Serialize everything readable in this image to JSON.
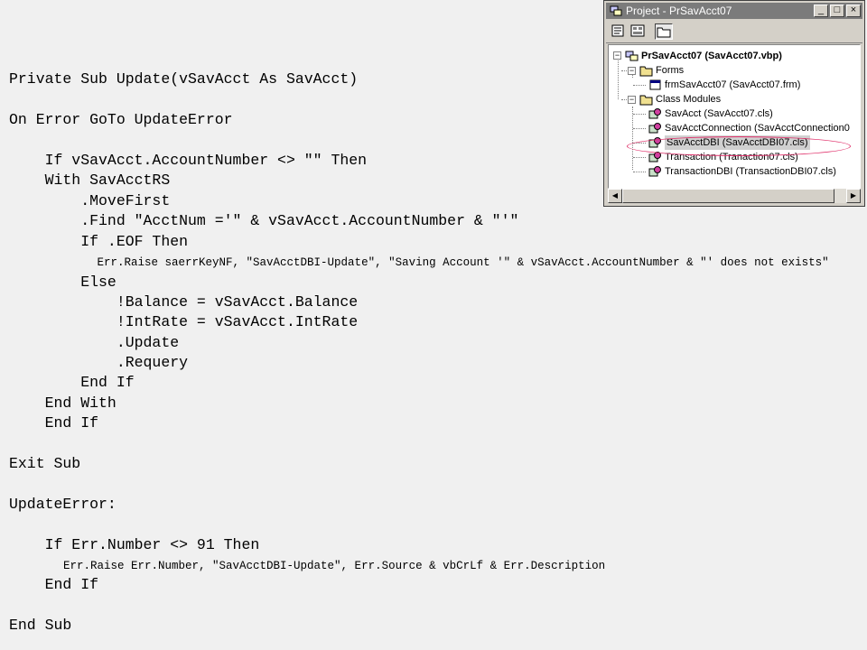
{
  "code": {
    "lines": [
      "Private Sub Update(vSavAcct As SavAcct)",
      "On Error GoTo UpdateError",
      "    If vSavAcct.AccountNumber <> \"\" Then",
      "    With SavAcctRS",
      "        .MoveFirst",
      "        .Find \"AcctNum ='\" & vSavAcct.AccountNumber & \"'\"",
      "        If .EOF Then",
      "             Err.Raise saerrKeyNF, \"SavAcctDBI-Update\", \"Saving Account '\" & vSavAcct.AccountNumber & \"' does not exists\"",
      "        Else",
      "            !Balance = vSavAcct.Balance",
      "            !IntRate = vSavAcct.IntRate",
      "            .Update",
      "            .Requery",
      "        End If",
      "    End With",
      "    End If",
      "Exit Sub",
      "UpdateError:",
      "    If Err.Number <> 91 Then",
      "        Err.Raise Err.Number, \"SavAcctDBI-Update\", Err.Source & vbCrLf & Err.Description",
      "    End If",
      "End Sub"
    ]
  },
  "project_window": {
    "title": "Project - PrSavAcct07",
    "min_glyph": "_",
    "max_glyph": "□",
    "close_glyph": "×",
    "tree": {
      "root": "PrSavAcct07 (SavAcct07.vbp)",
      "forms_folder": "Forms",
      "forms": [
        "frmSavAcct07 (SavAcct07.frm)"
      ],
      "class_folder": "Class Modules",
      "classes": [
        "SavAcct (SavAcct07.cls)",
        "SavAcctConnection (SavAcctConnection0",
        "SavAcctDBI (SavAcctDBI07.cls)",
        "Transaction (Tranaction07.cls)",
        "TransactionDBI (TransactionDBI07.cls)"
      ],
      "expand_glyph": "−"
    },
    "scroll_left": "◀",
    "scroll_right": "▶",
    "highlight_color": "#e0306a",
    "icons": [
      "project-icon",
      "view-code-icon",
      "view-object-icon",
      "toggle-folders-icon",
      "folder-icon",
      "form-icon",
      "class-module-icon"
    ]
  }
}
